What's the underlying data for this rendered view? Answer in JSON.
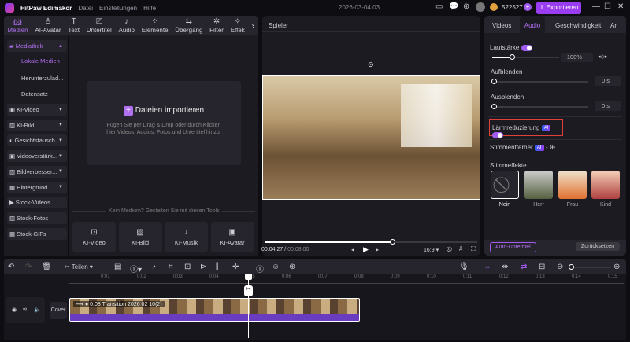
{
  "app": {
    "title": "HitPaw Edimakor",
    "menu": [
      "Datei",
      "Einstellungen",
      "Hilfe"
    ],
    "project_date": "2026-03-04 03",
    "credits": "522527",
    "export_label": "Exportieren"
  },
  "tabs": [
    {
      "label": "Medien",
      "icon": "media-icon",
      "active": true
    },
    {
      "label": "AI-Avatar",
      "icon": "avatar-icon"
    },
    {
      "label": "Text",
      "icon": "text-icon"
    },
    {
      "label": "Untertitel",
      "icon": "subtitle-icon"
    },
    {
      "label": "Audio",
      "icon": "audio-icon"
    },
    {
      "label": "Elemente",
      "icon": "elements-icon"
    },
    {
      "label": "Übergang",
      "icon": "transition-icon"
    },
    {
      "label": "Filter",
      "icon": "filter-icon"
    },
    {
      "label": "Effek",
      "icon": "effect-icon"
    }
  ],
  "sidebar": {
    "library": "Mediathek",
    "sub": [
      "Lokale Medien",
      "Herunterzulad...",
      "Datensatz"
    ],
    "items": [
      "KI-Video",
      "KI-Bild",
      "Gesichtstausch",
      "Videoverstärk...",
      "Bildverbesser...",
      "Hintergrund",
      "Stock-Videos",
      "Stock-Fotos",
      "Stock-GIFs"
    ]
  },
  "media": {
    "import_label": "Dateien importieren",
    "import_hint": "Fügen Sie per Drag & Drop oder durch Klicken hier Videos, Audios, Fotos und Untertitel hinzu.",
    "tools_heading": "Kein Medium? Gestalten Sie mit diesen Tools",
    "tools": [
      "KI-Video",
      "KI-Bild",
      "KI-Musik",
      "KI-Avatar"
    ]
  },
  "player": {
    "title": "Spieler",
    "current": "00:04:27",
    "total": "00:08:00",
    "progress": 0.6,
    "ratio": "16:9"
  },
  "right": {
    "tabs": [
      "Videos",
      "Audio",
      "Geschwindigkeit",
      "Ar"
    ],
    "active_tab": "Audio",
    "volume_label": "Lautstärke",
    "volume": "100%",
    "volume_fraction": 0.2,
    "fade_in_label": "Aufblenden",
    "fade_in": "0",
    "fade_out_label": "Ausblenden",
    "fade_out": "0",
    "unit": "s",
    "noise_label": "Lärmreduzierung",
    "ai": "AI",
    "voice_remover": "Stimmentferner",
    "voice_fx_label": "Stimmeffekte",
    "voice_fx": [
      "Nein",
      "Herr",
      "Frau",
      "Kind"
    ],
    "auto_sub": "Auto-Untertitel",
    "reset": "Zurücksetzen"
  },
  "timeline": {
    "split_label": "Teilen",
    "ruler": [
      "0:01",
      "0:02",
      "0:03",
      "0:04",
      "0:05",
      "0:06",
      "0:07",
      "0:08",
      "0:09",
      "0:10",
      "0:11",
      "0:12",
      "0:13",
      "0:14",
      "0:15"
    ],
    "cover": "Cover",
    "clip": "0:08 Transition 2026 02 10(2)"
  },
  "colors": {
    "accent": "#a25cf0",
    "highlight": "#e0403a"
  }
}
